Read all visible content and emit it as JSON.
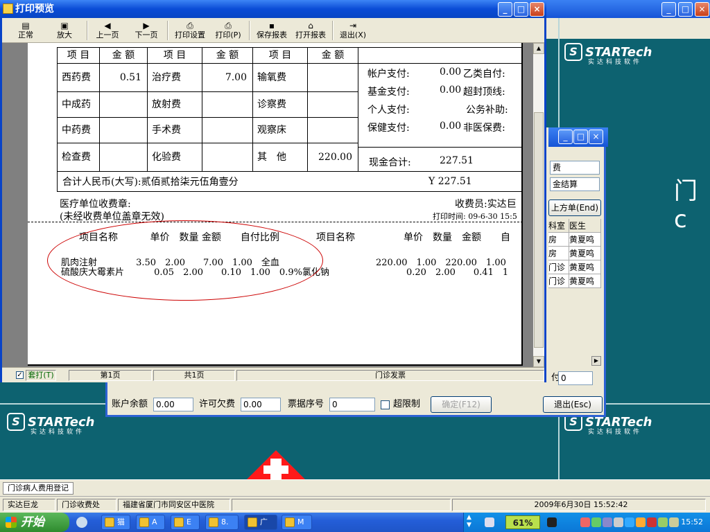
{
  "window": {
    "title": "打印预览",
    "minimize": "_",
    "maximize": "□",
    "close": "×"
  },
  "toolbar": {
    "normal": "正常",
    "zoom": "放大",
    "prev_page": "上一页",
    "next_page": "下一页",
    "print_setup": "打印设置",
    "print": "打印(P)",
    "save_report": "保存报表",
    "open_report": "打开报表",
    "exit": "退出(X)"
  },
  "receipt": {
    "header": [
      "项 目",
      "金 额",
      "项 目",
      "金 额",
      "项 目",
      "金 额"
    ],
    "rows": [
      {
        "c1": "西药费",
        "c2": "0.51",
        "c3": "治疗费",
        "c4": "7.00",
        "c5": "输氧费",
        "c6": ""
      },
      {
        "c1": "中成药",
        "c2": "",
        "c3": "放射费",
        "c4": "",
        "c5": "诊察费",
        "c6": ""
      },
      {
        "c1": "中药费",
        "c2": "",
        "c3": "手术费",
        "c4": "",
        "c5": "观察床",
        "c6": ""
      },
      {
        "c1": "检查费",
        "c2": "",
        "c3": "化验费",
        "c4": "",
        "c5": "其　他",
        "c6": "220.00"
      }
    ],
    "payment": [
      {
        "label": "帐户支付:",
        "value": "0.00",
        "right": "乙类自付:"
      },
      {
        "label": "基金支付:",
        "value": "0.00",
        "right": "超封顶线:"
      },
      {
        "label": "个人支付:",
        "value": "",
        "right": "公务补助:"
      },
      {
        "label": "保健支付:",
        "value": "0.00",
        "right": "非医保费:"
      }
    ],
    "cash_total_label": "现金合计:",
    "cash_total_value": "227.51",
    "total_rmb": "合计人民币(大写):贰佰贰拾柒元伍角壹分",
    "total_yen": "Y 227.51",
    "stamp_label": "医疗单位收费章:",
    "stamp_note": "(未经收费单位盖章无效)",
    "cashier": "收费员:实达巨",
    "print_time": "打印时间: 09-6-30 15:5",
    "detail_header_left": "项目名称　　　 单价　数量 金额　　自付比例",
    "detail_header_right": "项目名称　　　　　单价　数量　金额　　自",
    "detail_line1": "肌肉注射　　　　 3.50　2.00　　7.00　1.00　全血",
    "detail_line1_right": "220.00　1.00　220.00　1.00",
    "detail_line2": "硫酸庆大霉素片　　　 0.05　2.00　　0.10　1.00　0.9%氯化钠",
    "detail_line2_right": "0.20　2.00　　0.41　1"
  },
  "preview_status": {
    "checkbox_label": "套打(T)",
    "page": "第1页",
    "total": "共1页",
    "doc": "门诊发票"
  },
  "dialog2": {
    "field1": "费",
    "field2": "金结算",
    "btn_end": "上方单(End)",
    "grid_header": [
      "科室",
      "医生"
    ],
    "grid_rows": [
      [
        "房",
        "黄夏鸣"
      ],
      [
        "房",
        "黄夏鸣"
      ],
      [
        "门诊",
        "黄夏鸣"
      ],
      [
        "门诊",
        "黄夏鸣"
      ]
    ],
    "pay_label": "付",
    "pay_value": "0",
    "balance_label": "账户余额",
    "balance_value": "0.00",
    "debt_label": "许可欠费",
    "debt_value": "0.00",
    "ticket_label": "票据序号",
    "ticket_value": "0",
    "over_limit": "超限制",
    "confirm": "确定(F12)",
    "exit": "退出(Esc)"
  },
  "background": {
    "logo_text": "STARTech",
    "logo_sub": "实达科技软件",
    "big_char": "门 c"
  },
  "bottom": {
    "tab": "门诊病人费用登记",
    "status": [
      "实达巨龙",
      "门诊收费处",
      "福建省厦门市同安区中医院",
      "2009年6月30日 15:52:42"
    ]
  },
  "taskbar": {
    "start": "开始",
    "buttons": [
      "猫",
      "A",
      "E",
      "8.",
      "广",
      "M"
    ],
    "battery": "61%",
    "clock": "15:52"
  }
}
